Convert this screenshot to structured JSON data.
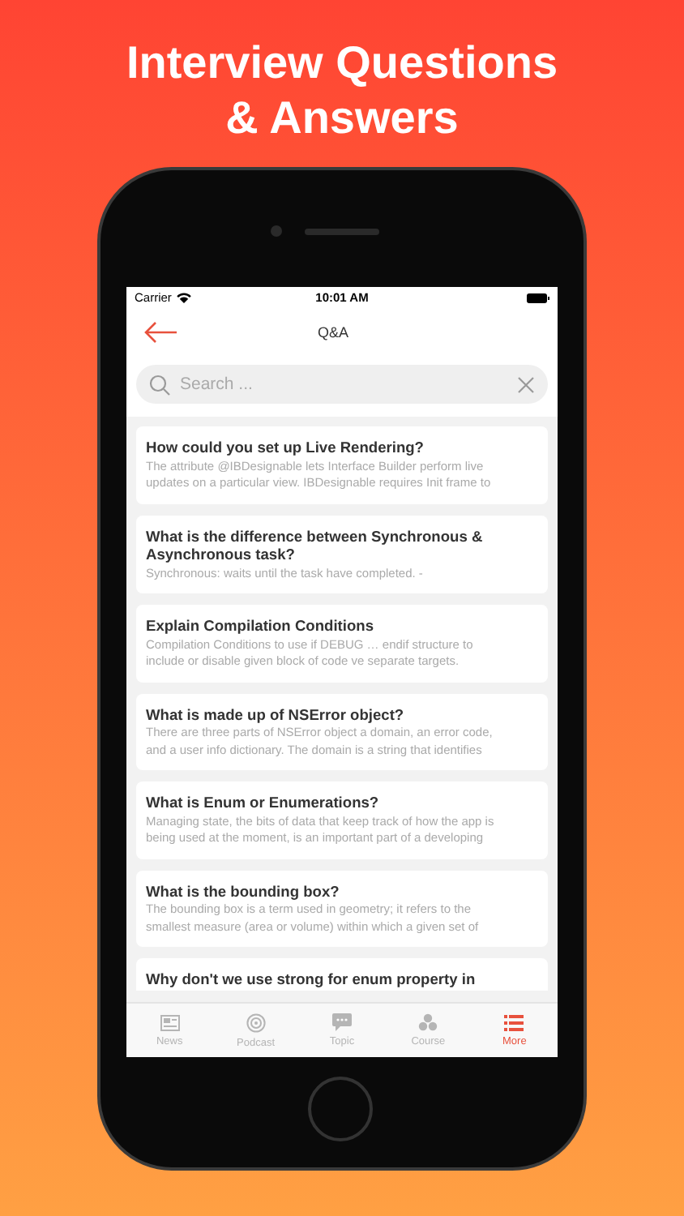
{
  "headline": [
    "Interview Questions",
    "& Answers"
  ],
  "status_bar": {
    "carrier": "Carrier",
    "time": "10:01 AM"
  },
  "nav": {
    "title": "Q&A"
  },
  "search": {
    "placeholder": "Search ..."
  },
  "questions": [
    {
      "title": [
        "How could you set up Live Rendering?"
      ],
      "body": [
        "The attribute @IBDesignable lets Interface Builder perform live",
        "updates on a particular view. IBDesignable requires Init frame to"
      ]
    },
    {
      "title": [
        "What is the difference between Synchronous &",
        "Asynchronous task?"
      ],
      "body": [
        "Synchronous: waits until the task have completed. -"
      ]
    },
    {
      "title": [
        "Explain Compilation Conditions"
      ],
      "body": [
        "Compilation Conditions to use if DEBUG … endif structure to",
        "include or disable given block of code ve separate targets."
      ]
    },
    {
      "title": [
        "What is made up of NSError object?"
      ],
      "body": [
        "There are three parts of NSError object a domain, an error code,",
        "and a user info dictionary. The domain is a string that identifies"
      ]
    },
    {
      "title": [
        "What is Enum or Enumerations?"
      ],
      "body": [
        "Managing state, the bits of data that keep track of how the app is",
        "being used at the moment, is an important part of a developing"
      ]
    },
    {
      "title": [
        "What is the bounding box?"
      ],
      "body": [
        "The bounding box is a term used in geometry; it refers to the",
        "smallest measure (area or volume) within which a given set of"
      ]
    },
    {
      "title": [
        "Why don't we use strong for enum property in"
      ]
    }
  ],
  "tabs": [
    {
      "label": "News",
      "kind": "news",
      "selected": false
    },
    {
      "label": "Podcast",
      "kind": "podcast",
      "selected": false
    },
    {
      "label": "Topic",
      "kind": "topic",
      "selected": false
    },
    {
      "label": "Course",
      "kind": "course",
      "selected": false
    },
    {
      "label": "More",
      "kind": "more",
      "selected": true
    }
  ]
}
